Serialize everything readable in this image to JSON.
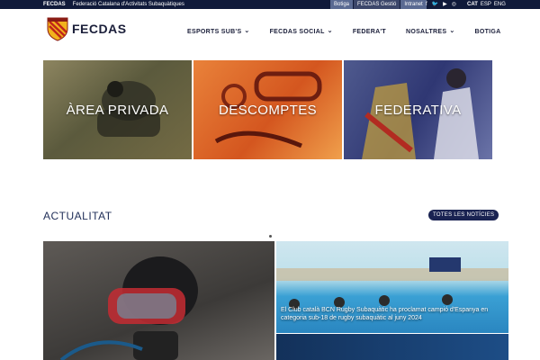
{
  "topbar": {
    "brand": "FECDAS",
    "org_name": "Federació Catalana d'Activitats Subaquàtiques",
    "tabs": [
      "Botiga",
      "FECDAS Gestió",
      "Intranet"
    ],
    "social_icons": [
      "facebook-icon",
      "twitter-icon",
      "youtube-icon",
      "instagram-icon"
    ],
    "languages": [
      "CAT",
      "ESP",
      "ENG"
    ]
  },
  "header": {
    "logo_text": "FECDAS",
    "nav": [
      {
        "label": "ESPORTS SUB'S",
        "has_dropdown": true
      },
      {
        "label": "FECDAS SOCIAL",
        "has_dropdown": true
      },
      {
        "label": "FEDERA'T",
        "has_dropdown": false
      },
      {
        "label": "NOSALTRES",
        "has_dropdown": true
      },
      {
        "label": "BOTIGA",
        "has_dropdown": false
      }
    ]
  },
  "tiles": [
    {
      "label": "ÀREA PRIVADA"
    },
    {
      "label": "DESCOMPTES"
    },
    {
      "label": "FEDERATIVA"
    }
  ],
  "news": {
    "section_title": "ACTUALITAT",
    "all_news_label": "TOTES LES NOTÍCIES",
    "featured_caption": "El Club català BCN Rugby Subaquàtic ha proclamat campió d'Espanya en categoria sub-18 de rugby subaquàtic al juny 2024"
  }
}
